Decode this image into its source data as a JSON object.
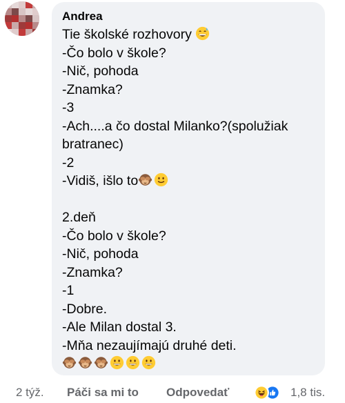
{
  "comment": {
    "author": "Andrea",
    "lines": [
      {
        "text": "Tie školské rozhovory ",
        "emojis": [
          "grinning-sweat-emoji"
        ]
      },
      {
        "text": "-Čo bolo v škole?",
        "emojis": []
      },
      {
        "text": "-Nič, pohoda",
        "emojis": []
      },
      {
        "text": "-Znamka?",
        "emojis": []
      },
      {
        "text": "-3",
        "emojis": []
      },
      {
        "text": "-Ach....a čo dostal Milanko?(spolužiak bratranec)",
        "emojis": [],
        "wrap": true
      },
      {
        "text": "-2",
        "emojis": []
      },
      {
        "text": "-Vidiš, išlo to",
        "emojis": [
          "see-no-evil-monkey-emoji",
          "slightly-smiling-face-emoji"
        ]
      },
      {
        "text": "",
        "emojis": [],
        "blank": true
      },
      {
        "text": "2.deň",
        "emojis": []
      },
      {
        "text": "-Čo bolo v škole?",
        "emojis": []
      },
      {
        "text": "-Nič, pohoda",
        "emojis": []
      },
      {
        "text": "-Znamka?",
        "emojis": []
      },
      {
        "text": "-1",
        "emojis": []
      },
      {
        "text": "-Dobre.",
        "emojis": []
      },
      {
        "text": "-Ale Milan dostal 3.",
        "emojis": []
      },
      {
        "text": "-Mňa nezaujímajú druhé deti.",
        "emojis": []
      },
      {
        "text": "",
        "emojis": [
          "see-no-evil-monkey-emoji",
          "see-no-evil-monkey-emoji",
          "see-no-evil-monkey-emoji",
          "grinning-face-emoji",
          "grinning-face-emoji",
          "grinning-face-emoji"
        ]
      }
    ]
  },
  "footer": {
    "time": "2 týž.",
    "like_label": "Páči sa mi to",
    "reply_label": "Odpovedať",
    "reaction_count": "1,8 tis.",
    "reactions": [
      "haha-reaction-icon",
      "like-reaction-icon"
    ]
  },
  "colors": {
    "bubble_bg": "#f0f2f5",
    "text": "#050505",
    "meta_text": "#65676b",
    "like_blue": "#1877f2",
    "emoji_yellow": "#ffcc33"
  }
}
